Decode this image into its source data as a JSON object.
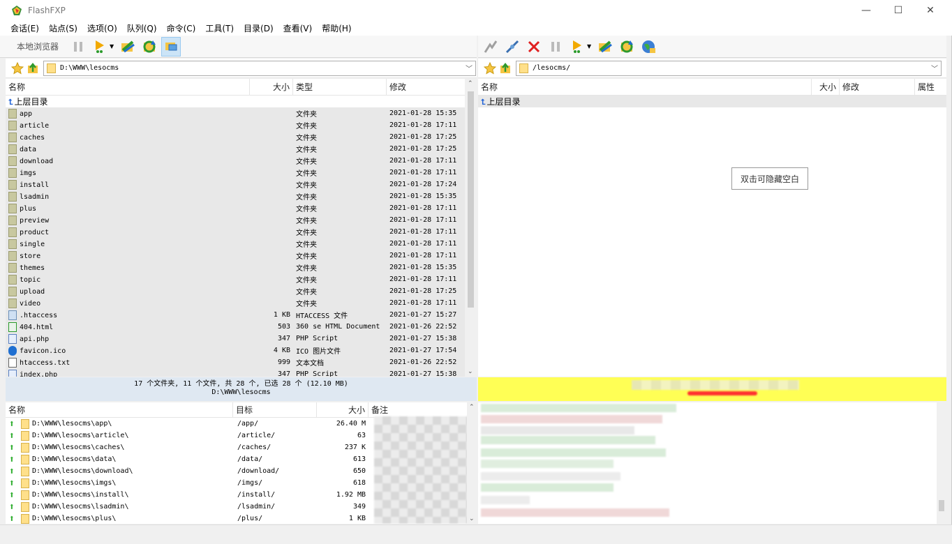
{
  "app": {
    "title": "FlashFXP"
  },
  "window_controls": {
    "minimize": "—",
    "maximize": "☐",
    "close": "✕"
  },
  "menu": [
    "会话(E)",
    "站点(S)",
    "选项(O)",
    "队列(Q)",
    "命令(C)",
    "工具(T)",
    "目录(D)",
    "查看(V)",
    "帮助(H)"
  ],
  "local_toolbar": {
    "label": "本地浏览器"
  },
  "local_path": "D:\\WWW\\lesocms",
  "remote_path": "/lesocms/",
  "local_columns": [
    "名称",
    "大小",
    "类型",
    "修改"
  ],
  "remote_columns": [
    "名称",
    "大小",
    "修改",
    "属性"
  ],
  "parent_dir": "上层目录",
  "local_files": [
    {
      "name": "app",
      "size": "",
      "type": "文件夹",
      "modified": "2021-01-28 15:35",
      "kind": "folder"
    },
    {
      "name": "article",
      "size": "",
      "type": "文件夹",
      "modified": "2021-01-28 17:11",
      "kind": "folder"
    },
    {
      "name": "caches",
      "size": "",
      "type": "文件夹",
      "modified": "2021-01-28 17:25",
      "kind": "folder"
    },
    {
      "name": "data",
      "size": "",
      "type": "文件夹",
      "modified": "2021-01-28 17:25",
      "kind": "folder"
    },
    {
      "name": "download",
      "size": "",
      "type": "文件夹",
      "modified": "2021-01-28 17:11",
      "kind": "folder"
    },
    {
      "name": "imgs",
      "size": "",
      "type": "文件夹",
      "modified": "2021-01-28 17:11",
      "kind": "folder"
    },
    {
      "name": "install",
      "size": "",
      "type": "文件夹",
      "modified": "2021-01-28 17:24",
      "kind": "folder"
    },
    {
      "name": "lsadmin",
      "size": "",
      "type": "文件夹",
      "modified": "2021-01-28 15:35",
      "kind": "folder"
    },
    {
      "name": "plus",
      "size": "",
      "type": "文件夹",
      "modified": "2021-01-28 17:11",
      "kind": "folder"
    },
    {
      "name": "preview",
      "size": "",
      "type": "文件夹",
      "modified": "2021-01-28 17:11",
      "kind": "folder"
    },
    {
      "name": "product",
      "size": "",
      "type": "文件夹",
      "modified": "2021-01-28 17:11",
      "kind": "folder"
    },
    {
      "name": "single",
      "size": "",
      "type": "文件夹",
      "modified": "2021-01-28 17:11",
      "kind": "folder"
    },
    {
      "name": "store",
      "size": "",
      "type": "文件夹",
      "modified": "2021-01-28 17:11",
      "kind": "folder"
    },
    {
      "name": "themes",
      "size": "",
      "type": "文件夹",
      "modified": "2021-01-28 15:35",
      "kind": "folder"
    },
    {
      "name": "topic",
      "size": "",
      "type": "文件夹",
      "modified": "2021-01-28 17:11",
      "kind": "folder"
    },
    {
      "name": "upload",
      "size": "",
      "type": "文件夹",
      "modified": "2021-01-28 17:25",
      "kind": "folder"
    },
    {
      "name": "video",
      "size": "",
      "type": "文件夹",
      "modified": "2021-01-28 17:11",
      "kind": "folder"
    },
    {
      "name": ".htaccess",
      "size": "1 KB",
      "type": "HTACCESS 文件",
      "modified": "2021-01-27 15:27",
      "kind": "file"
    },
    {
      "name": "404.html",
      "size": "503",
      "type": "360 se HTML Document",
      "modified": "2021-01-26 22:52",
      "kind": "html"
    },
    {
      "name": "api.php",
      "size": "347",
      "type": "PHP Script",
      "modified": "2021-01-27 15:38",
      "kind": "php"
    },
    {
      "name": "favicon.ico",
      "size": "4 KB",
      "type": "ICO 图片文件",
      "modified": "2021-01-27 17:54",
      "kind": "ico"
    },
    {
      "name": "htaccess.txt",
      "size": "999",
      "type": "文本文档",
      "modified": "2021-01-26 22:52",
      "kind": "txt"
    },
    {
      "name": "index.php",
      "size": "347",
      "type": "PHP Script",
      "modified": "2021-01-27 15:38",
      "kind": "php"
    }
  ],
  "local_status": {
    "line1": "17 个文件夹, 11 个文件, 共 28 个, 已选 28 个 (12.10 MB)",
    "line2": "D:\\WWW\\lesocms"
  },
  "remote_hint": "双击可隐藏空白",
  "queue_columns": [
    "名称",
    "目标",
    "大小",
    "备注"
  ],
  "queue": [
    {
      "name": "D:\\WWW\\lesocms\\app\\",
      "target": "/app/",
      "size": "26.40 M"
    },
    {
      "name": "D:\\WWW\\lesocms\\article\\",
      "target": "/article/",
      "size": "63"
    },
    {
      "name": "D:\\WWW\\lesocms\\caches\\",
      "target": "/caches/",
      "size": "237 K"
    },
    {
      "name": "D:\\WWW\\lesocms\\data\\",
      "target": "/data/",
      "size": "613"
    },
    {
      "name": "D:\\WWW\\lesocms\\download\\",
      "target": "/download/",
      "size": "650"
    },
    {
      "name": "D:\\WWW\\lesocms\\imgs\\",
      "target": "/imgs/",
      "size": "618"
    },
    {
      "name": "D:\\WWW\\lesocms\\install\\",
      "target": "/install/",
      "size": "1.92 MB"
    },
    {
      "name": "D:\\WWW\\lesocms\\lsadmin\\",
      "target": "/lsadmin/",
      "size": "349"
    },
    {
      "name": "D:\\WWW\\lesocms\\plus\\",
      "target": "/plus/",
      "size": "1 KB"
    }
  ],
  "colors": {
    "selection": "#e8e8e8",
    "status_bg": "#dfe8f2",
    "remote_status": "#ffff55",
    "accent": "#cce4f7"
  }
}
